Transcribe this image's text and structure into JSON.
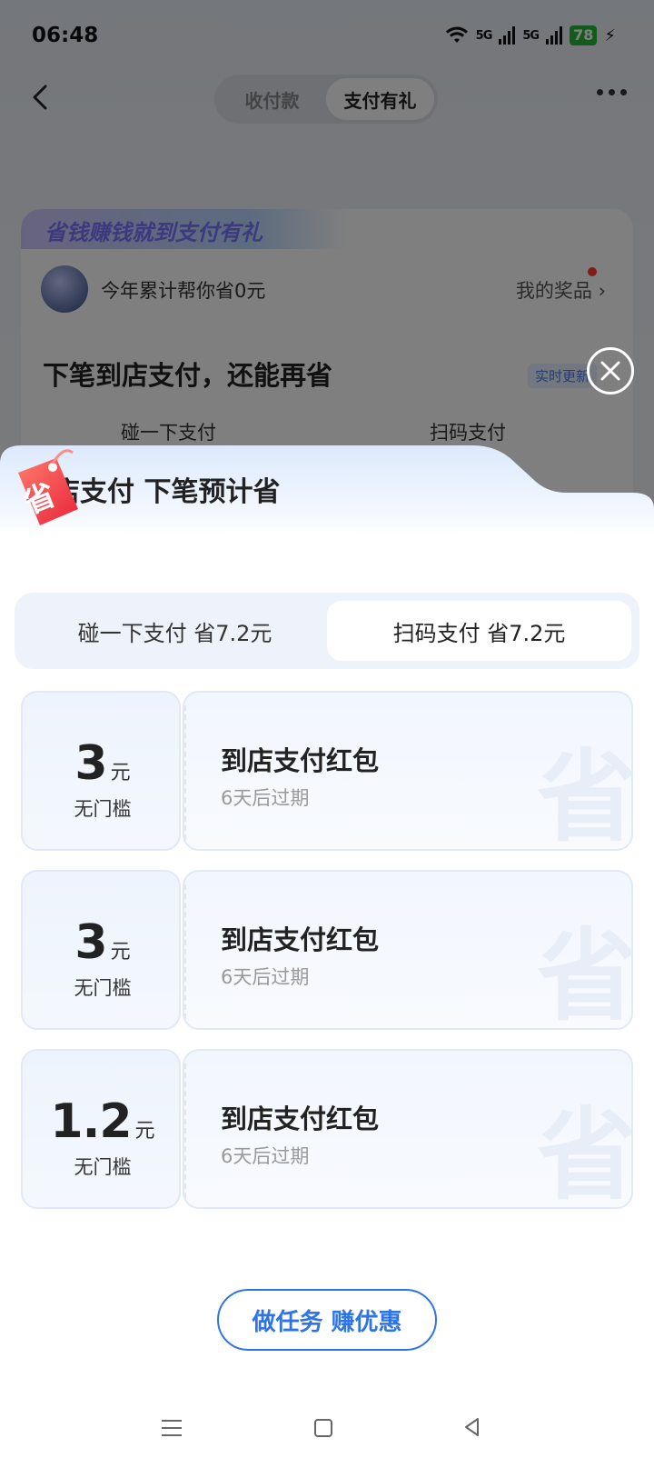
{
  "status_bar": {
    "time": "06:48",
    "network1": "5G",
    "network2": "5G",
    "battery": "78"
  },
  "nav": {
    "segments": [
      {
        "label": "收付款",
        "active": false
      },
      {
        "label": "支付有礼",
        "active": true
      }
    ]
  },
  "background_card": {
    "banner": "省钱赚钱就到支付有礼",
    "saved_text": "今年累计帮你省0元",
    "prize_link": "我的奖品",
    "section_title": "下笔到店支付，还能再省",
    "realtime_badge": "实时更新",
    "option1": "碰一下支付",
    "option2": "扫码支付"
  },
  "sheet": {
    "title": "到店支付 下笔预计省",
    "tag_icon_char": "省",
    "tabs": [
      {
        "label": "碰一下支付 省7.2元",
        "active": false
      },
      {
        "label": "扫码支付 省7.2元",
        "active": true
      }
    ],
    "coupons": [
      {
        "amount": "3",
        "unit": "元",
        "threshold": "无门槛",
        "title": "到店支付红包",
        "expiry": "6天后过期"
      },
      {
        "amount": "3",
        "unit": "元",
        "threshold": "无门槛",
        "title": "到店支付红包",
        "expiry": "6天后过期"
      },
      {
        "amount": "1.2",
        "unit": "元",
        "threshold": "无门槛",
        "title": "到店支付红包",
        "expiry": "6天后过期"
      }
    ],
    "watermark_char": "省",
    "task_button": "做任务 赚优惠"
  },
  "colors": {
    "accent": "#2f74e6",
    "battery": "#27b438",
    "mask": "rgba(0,0,0,0.5)"
  }
}
